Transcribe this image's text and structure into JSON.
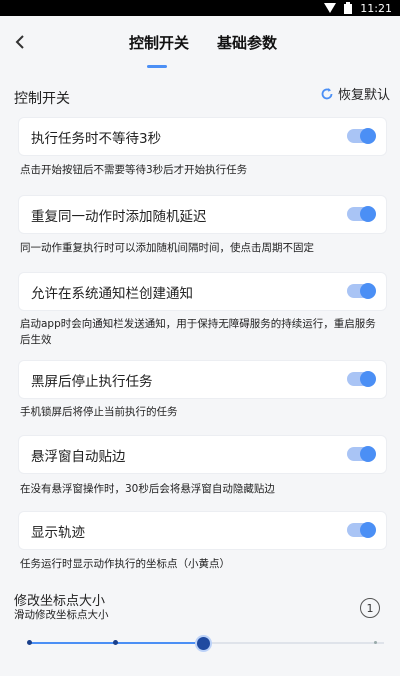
{
  "status_bar": {
    "time": "11:21"
  },
  "header": {
    "tabs": [
      {
        "label": "控制开关",
        "active": true
      },
      {
        "label": "基础参数",
        "active": false
      }
    ]
  },
  "section": {
    "title": "控制开关",
    "restore_label": "恢复默认"
  },
  "settings": [
    {
      "label": "执行任务时不等待3秒",
      "enabled": true,
      "desc": "点击开始按钮后不需要等待3秒后才开始执行任务"
    },
    {
      "label": "重复同一动作时添加随机延迟",
      "enabled": true,
      "desc": "同一动作重复执行时可以添加随机间隔时间，使点击周期不固定"
    },
    {
      "label": "允许在系统通知栏创建通知",
      "enabled": true,
      "desc": "启动app时会向通知栏发送通知，用于保持无障碍服务的持续运行，重启服务后生效"
    },
    {
      "label": "黑屏后停止执行任务",
      "enabled": true,
      "desc": "手机锁屏后将停止当前执行的任务"
    },
    {
      "label": "悬浮窗自动贴边",
      "enabled": true,
      "desc": "在没有悬浮窗操作时，30秒后会将悬浮窗自动隐藏贴边"
    },
    {
      "label": "显示轨迹",
      "enabled": true,
      "desc": "任务运行时显示动作执行的坐标点（小黄点）"
    }
  ],
  "slider": {
    "title": "修改坐标点大小",
    "subtitle": "滑动修改坐标点大小",
    "info_label": "1",
    "value_fraction": 0.49
  },
  "colors": {
    "accent": "#4b8ff5",
    "background": "#f5f6f8"
  }
}
